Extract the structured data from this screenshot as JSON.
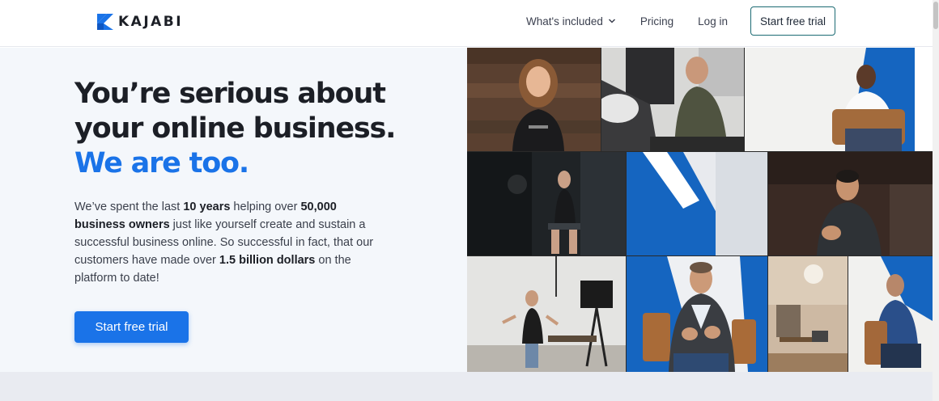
{
  "header": {
    "brand": "KAJABI",
    "nav": {
      "whats_included": "What's included",
      "pricing": "Pricing",
      "login": "Log in",
      "trial": "Start free trial"
    }
  },
  "hero": {
    "headline_line1": "You’re serious about",
    "headline_line2": "your online business.",
    "headline_line3": "We are too.",
    "body": {
      "t1": "We’ve spent the last ",
      "b1": "10 years",
      "t2": " helping over ",
      "b2": "50,000",
      "b3": "business owners",
      "t3": " just like yourself create and sustain a successful business online. So successful in fact, that our customers have made over ",
      "b4": "1.5 billion dollars",
      "t4": " on the platform to date!"
    },
    "cta": "Start free trial"
  },
  "colors": {
    "accent": "#1a73e8",
    "hero_bg": "#f4f7fb",
    "text_dark": "#1c1f26",
    "cta_border": "#1c6b73"
  },
  "icons": {
    "logo": "kajabi-logo-icon",
    "nav_dropdown": "chevron-down-icon"
  }
}
